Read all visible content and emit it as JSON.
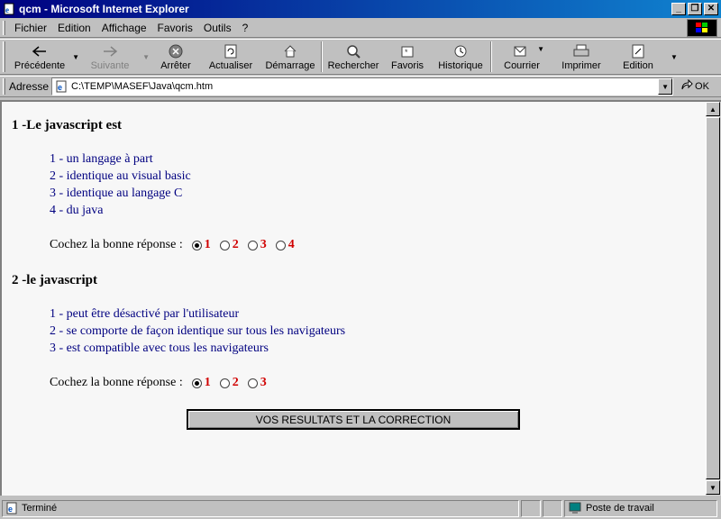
{
  "window": {
    "title": "qcm - Microsoft Internet Explorer"
  },
  "menu": {
    "items": [
      "Fichier",
      "Edition",
      "Affichage",
      "Favoris",
      "Outils",
      "?"
    ]
  },
  "toolbar": {
    "back": "Précédente",
    "forward": "Suivante",
    "stop": "Arrêter",
    "refresh": "Actualiser",
    "home": "Démarrage",
    "search": "Rechercher",
    "favorites": "Favoris",
    "history": "Historique",
    "mail": "Courrier",
    "print": "Imprimer",
    "edit": "Edition"
  },
  "address": {
    "label": "Adresse",
    "value": "C:\\TEMP\\MASEF\\Java\\qcm.htm",
    "go": "OK"
  },
  "quiz": {
    "q1": {
      "title": "1 -Le javascript est",
      "options": [
        "1 - un langage à part",
        "2 - identique au visual basic",
        "3 - identique au langage C",
        "4 - du java"
      ],
      "prompt": "Cochez la bonne réponse :",
      "choices": [
        "1",
        "2",
        "3",
        "4"
      ],
      "selected": "1"
    },
    "q2": {
      "title": "2 -le javascript",
      "options": [
        "1 - peut être désactivé par l'utilisateur",
        "2 - se comporte de façon identique sur tous les navigateurs",
        "3 - est compatible avec tous les navigateurs"
      ],
      "prompt": "Cochez la bonne réponse :",
      "choices": [
        "1",
        "2",
        "3"
      ],
      "selected": "1"
    },
    "submit": "VOS RESULTATS ET LA CORRECTION"
  },
  "status": {
    "text": "Terminé",
    "zone": "Poste de travail"
  },
  "colors": {
    "titlebar": "#000080",
    "option_text": "#000080",
    "choice_number": "#d00000",
    "page_bg": "#f7f7f7"
  }
}
